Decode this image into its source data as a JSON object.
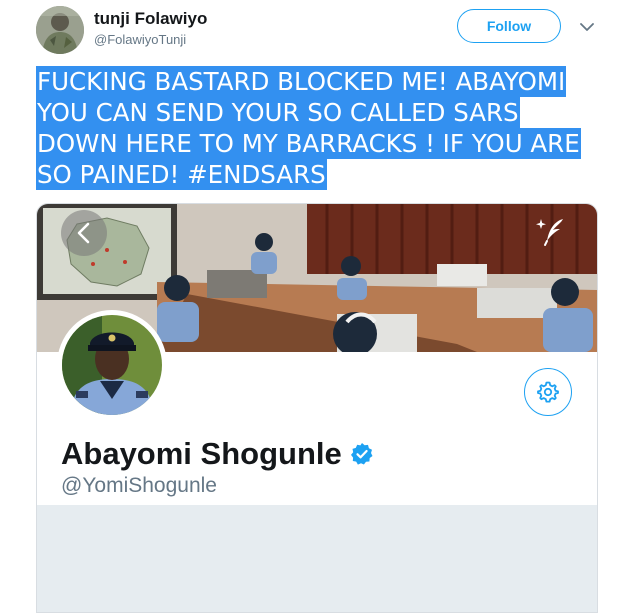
{
  "tweet": {
    "author_name": "tunji Folawiyo",
    "author_handle": "@FolawiyoTunji",
    "follow_label": "Follow",
    "text_lines": [
      "FUCKING BASTARD BLOCKED ME! ABAYOMI",
      "YOU CAN SEND YOUR SO CALLED SARS",
      "DOWN HERE TO MY BARRACKS ! IF YOU ARE",
      "SO PAINED! #ENDSARS"
    ],
    "icons": {
      "author_avatar": "avatar-photo",
      "caret": "chevron-down-icon"
    }
  },
  "media": {
    "profile_name": "Abayomi Shogunle",
    "profile_handle": "@YomiShogunle",
    "icons": {
      "back": "chevron-left-icon",
      "compose": "compose-sparkle-icon",
      "settings": "gear-icon",
      "verified": "verified-badge-icon"
    }
  },
  "colors": {
    "accent": "#1da1f2",
    "selection": "#3390f0",
    "footer_gray": "#e6ecf0"
  }
}
